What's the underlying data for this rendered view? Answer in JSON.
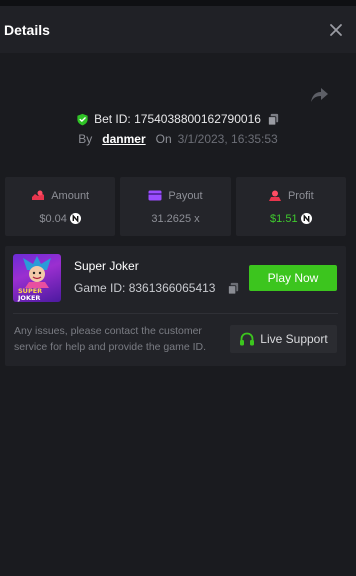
{
  "header": {
    "title": "Details"
  },
  "bet": {
    "id_label": "Bet ID:",
    "id_value": "1754038800162790016",
    "by_label": "By",
    "user": "danmer",
    "on_label": "On",
    "datetime": "3/1/2023, 16:35:53"
  },
  "stats": {
    "amount": {
      "label": "Amount",
      "value": "$0.04"
    },
    "payout": {
      "label": "Payout",
      "value": "31.2625 x"
    },
    "profit": {
      "label": "Profit",
      "value": "$1.51"
    }
  },
  "game": {
    "name": "Super Joker",
    "id_label": "Game ID:",
    "id_value": "8361366065413",
    "thumb_text_1": "SUPER",
    "thumb_text_2": "JOKER",
    "play_label": "Play Now"
  },
  "support": {
    "notice": "Any issues, please contact the customer service for help and provide the game ID.",
    "button_label": "Live Support"
  },
  "colors": {
    "accent_green": "#3cc51e",
    "profit_green": "#3fc92e",
    "background": "#1a1b1f"
  },
  "icons": [
    "close-icon",
    "share-icon",
    "shield-check-icon",
    "copy-icon",
    "coins-icon",
    "card-icon",
    "profit-icon",
    "currency-coin-icon",
    "headset-icon"
  ]
}
